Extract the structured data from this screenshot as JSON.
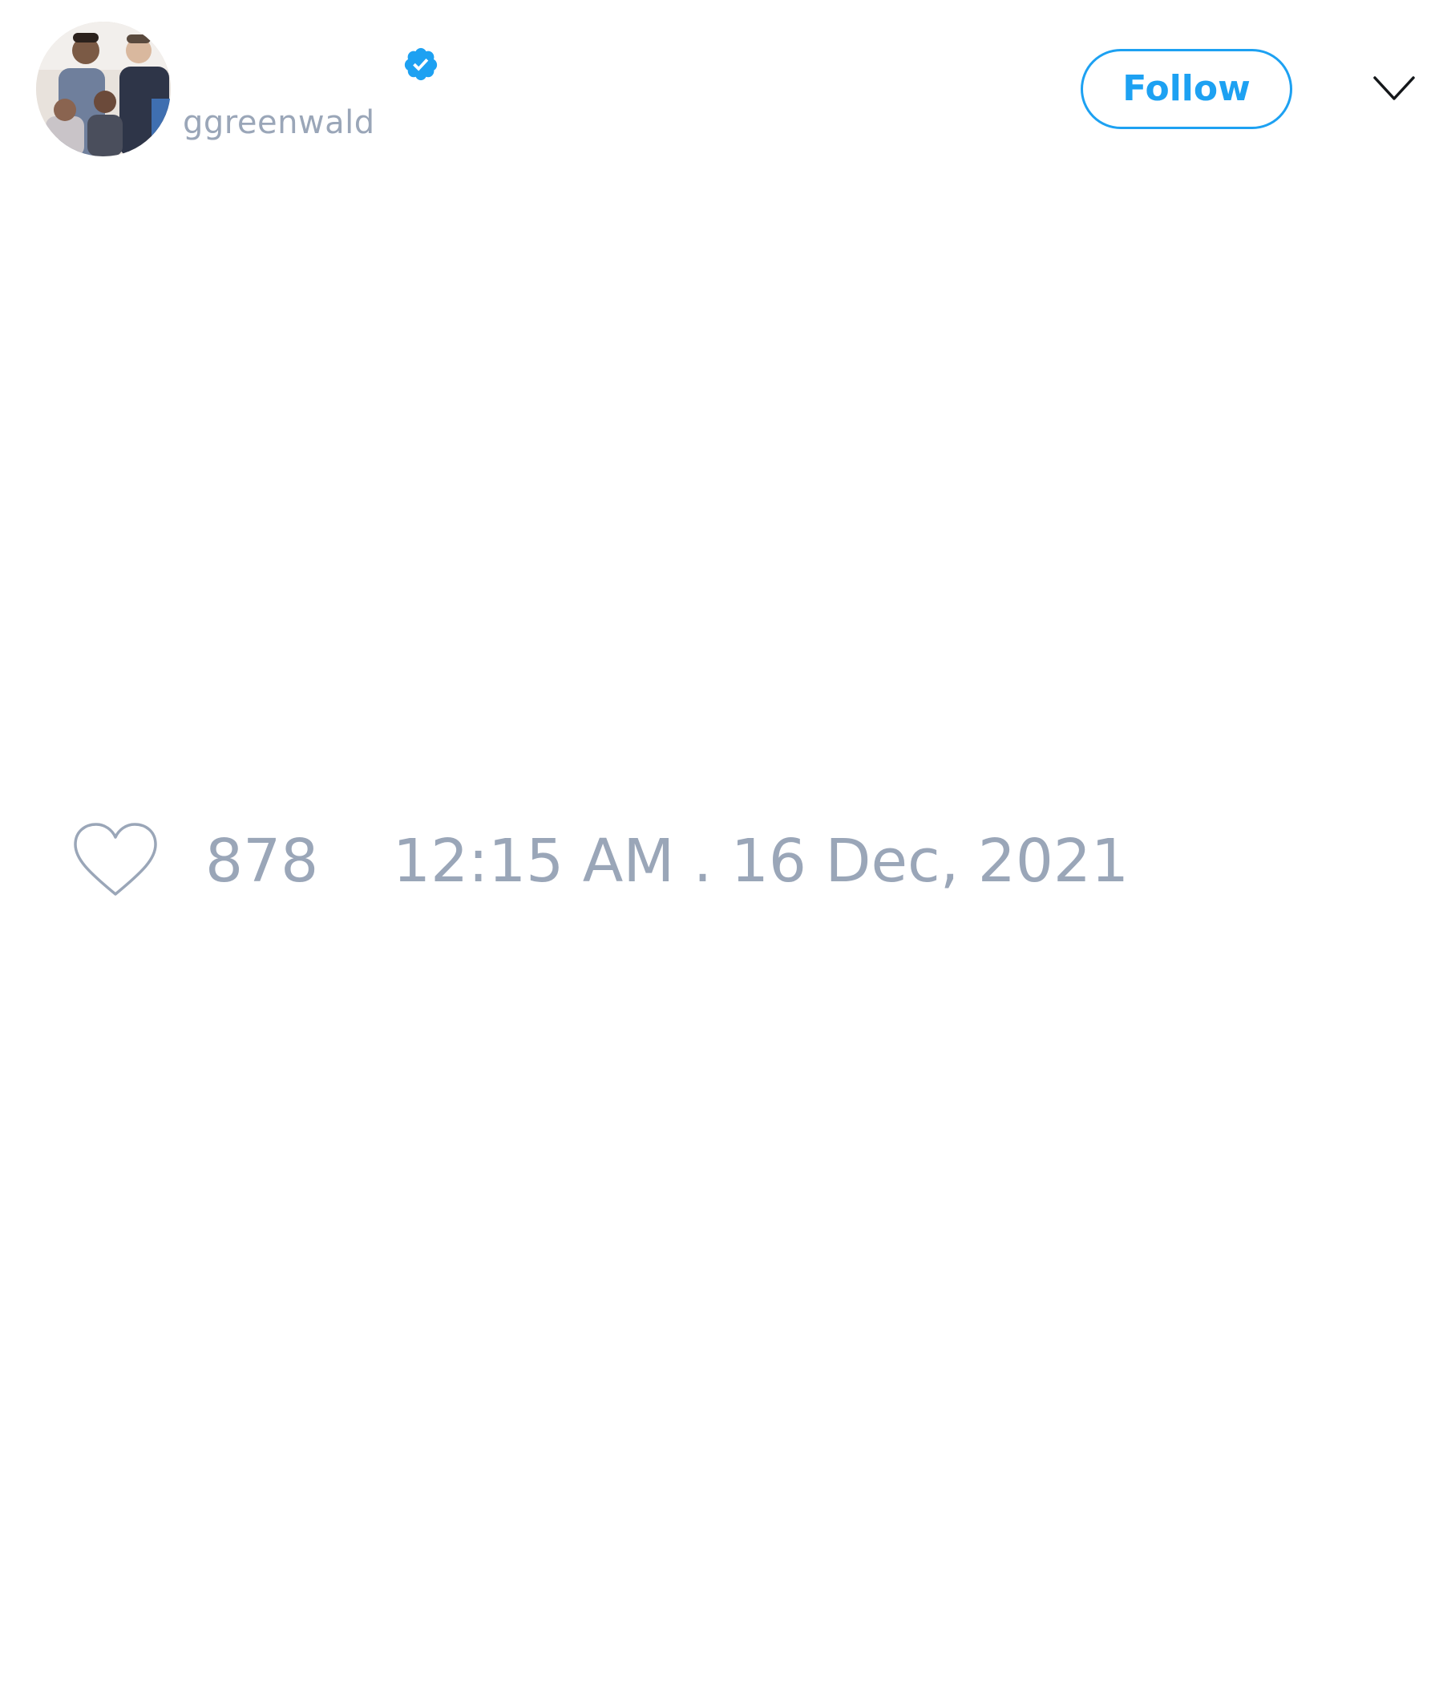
{
  "tweet": {
    "author": {
      "display_name": "",
      "handle": "ggreenwald",
      "verified": true,
      "avatar_icon": "profile-photo"
    },
    "follow_label": "Follow",
    "menu_icon": "chevron-down-icon",
    "likes": {
      "icon": "heart-icon",
      "count": "878"
    },
    "timestamp": "12:15 AM . 16 Dec, 2021"
  },
  "colors": {
    "accent": "#1da1f2",
    "muted_text": "#9aa6b8",
    "background": "#ffffff"
  }
}
